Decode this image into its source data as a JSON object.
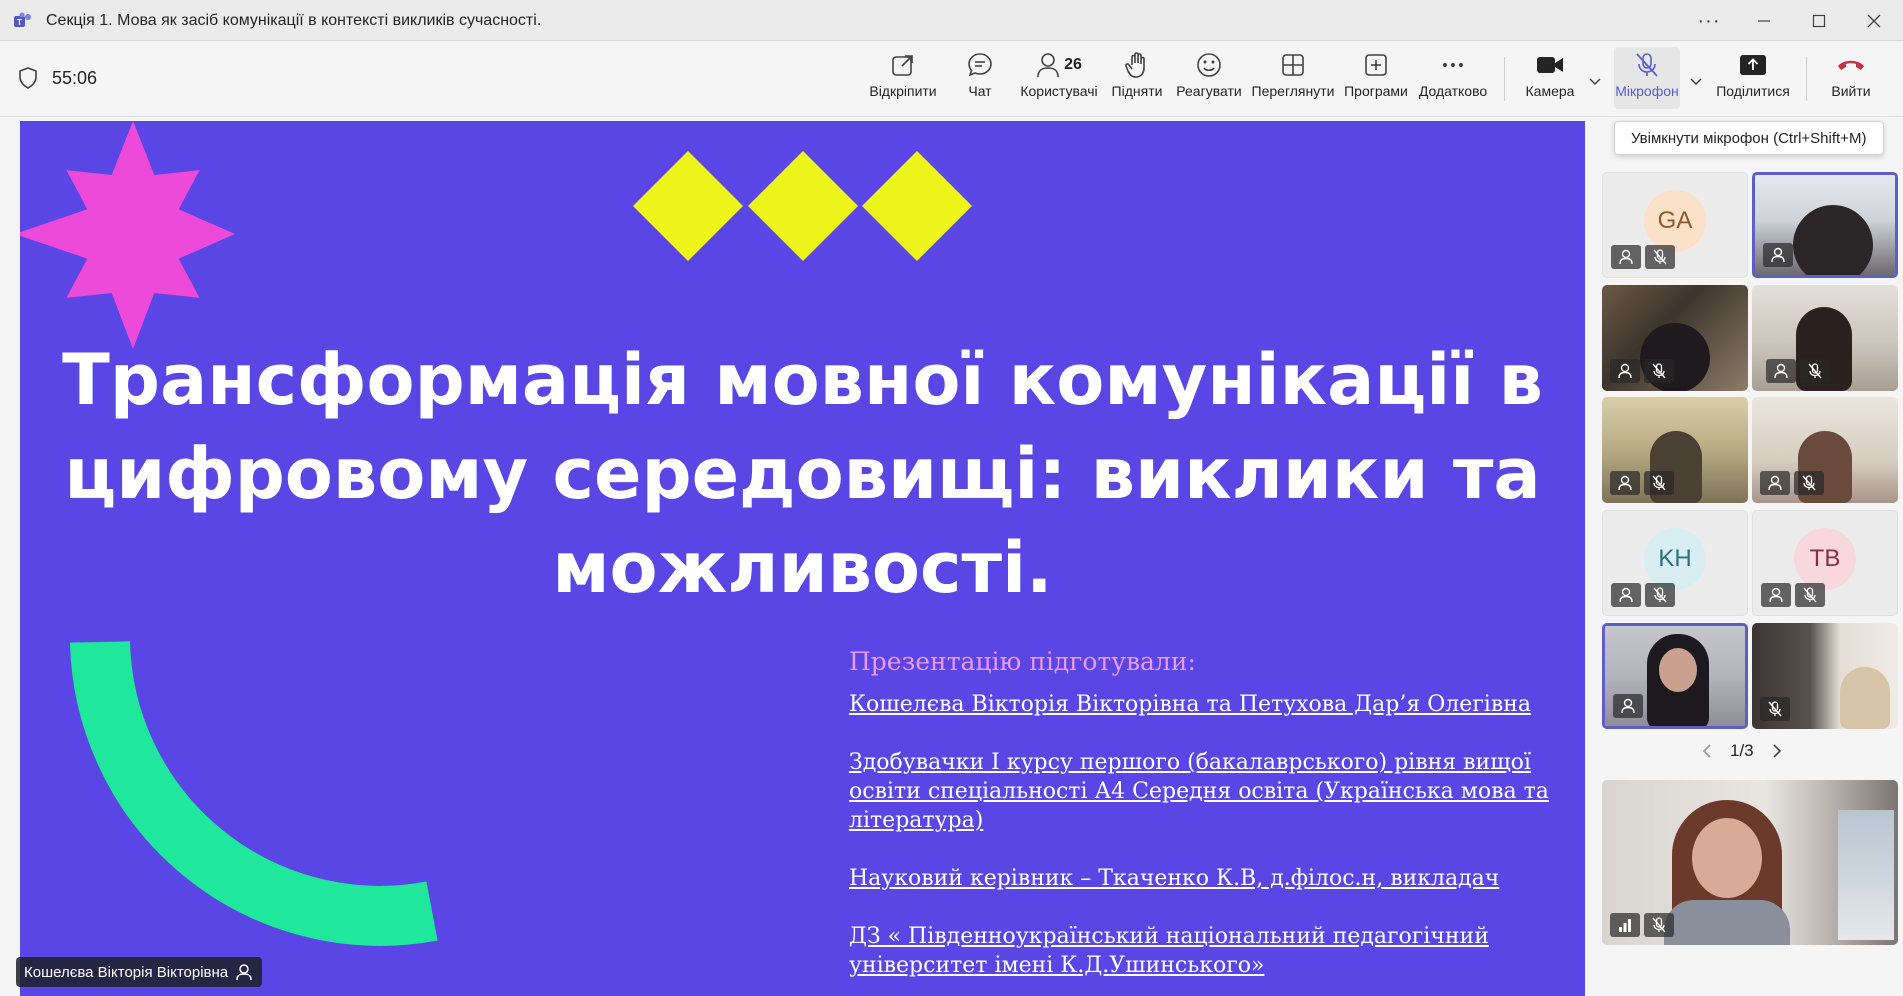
{
  "window": {
    "title": "Секція 1. Мова як засіб комунікації в контексті викликів сучасності."
  },
  "toolbar": {
    "timer": "55:06",
    "buttons": {
      "popout": "Відкріпити",
      "chat": "Чат",
      "people": "Користувачі",
      "people_count": "26",
      "raise": "Підняти",
      "react": "Реагувати",
      "view": "Переглянути",
      "apps": "Програми",
      "more": "Додатково",
      "camera": "Камера",
      "mic": "Мікрофон",
      "share": "Поділитися",
      "leave": "Вийти"
    },
    "mic_tooltip": "Увімкнути мікрофон (Ctrl+Shift+M)"
  },
  "slide": {
    "title": "Трансформація мовної комунікації в цифровому середовищі: виклики та можливості.",
    "credits_heading": "Презентацію підготували:",
    "credits": [
      "Кошелєва Вікторія Вікторівна та Петухова Дар’я Олегівна",
      "Здобувачки І курсу першого (бакалаврського) рівня вищої освіти спеціальності А4 Середня освіта (Українська мова та література)",
      "Науковий керівник – Ткаченко К.В, д.філос.н, викладач",
      "ДЗ « Південноукраїнський національний педагогічний університет імені К.Д.Ушинського»"
    ],
    "colors": {
      "background": "#5a46e5",
      "star": "#ed4ad9",
      "diamonds": "#eef51a",
      "arc": "#1fe89c"
    }
  },
  "presenter": {
    "name": "Кошелєва Вікторія Вікторівна"
  },
  "participants": {
    "avatars": [
      {
        "initials": "GA",
        "bg": "#fbe1c8",
        "fg": "#8a5a2b"
      },
      {
        "initials": "KH",
        "bg": "#d8eef2",
        "fg": "#2d6f7d"
      },
      {
        "initials": "TB",
        "bg": "#f8d7df",
        "fg": "#8b2d45"
      }
    ],
    "page": "1/3"
  }
}
